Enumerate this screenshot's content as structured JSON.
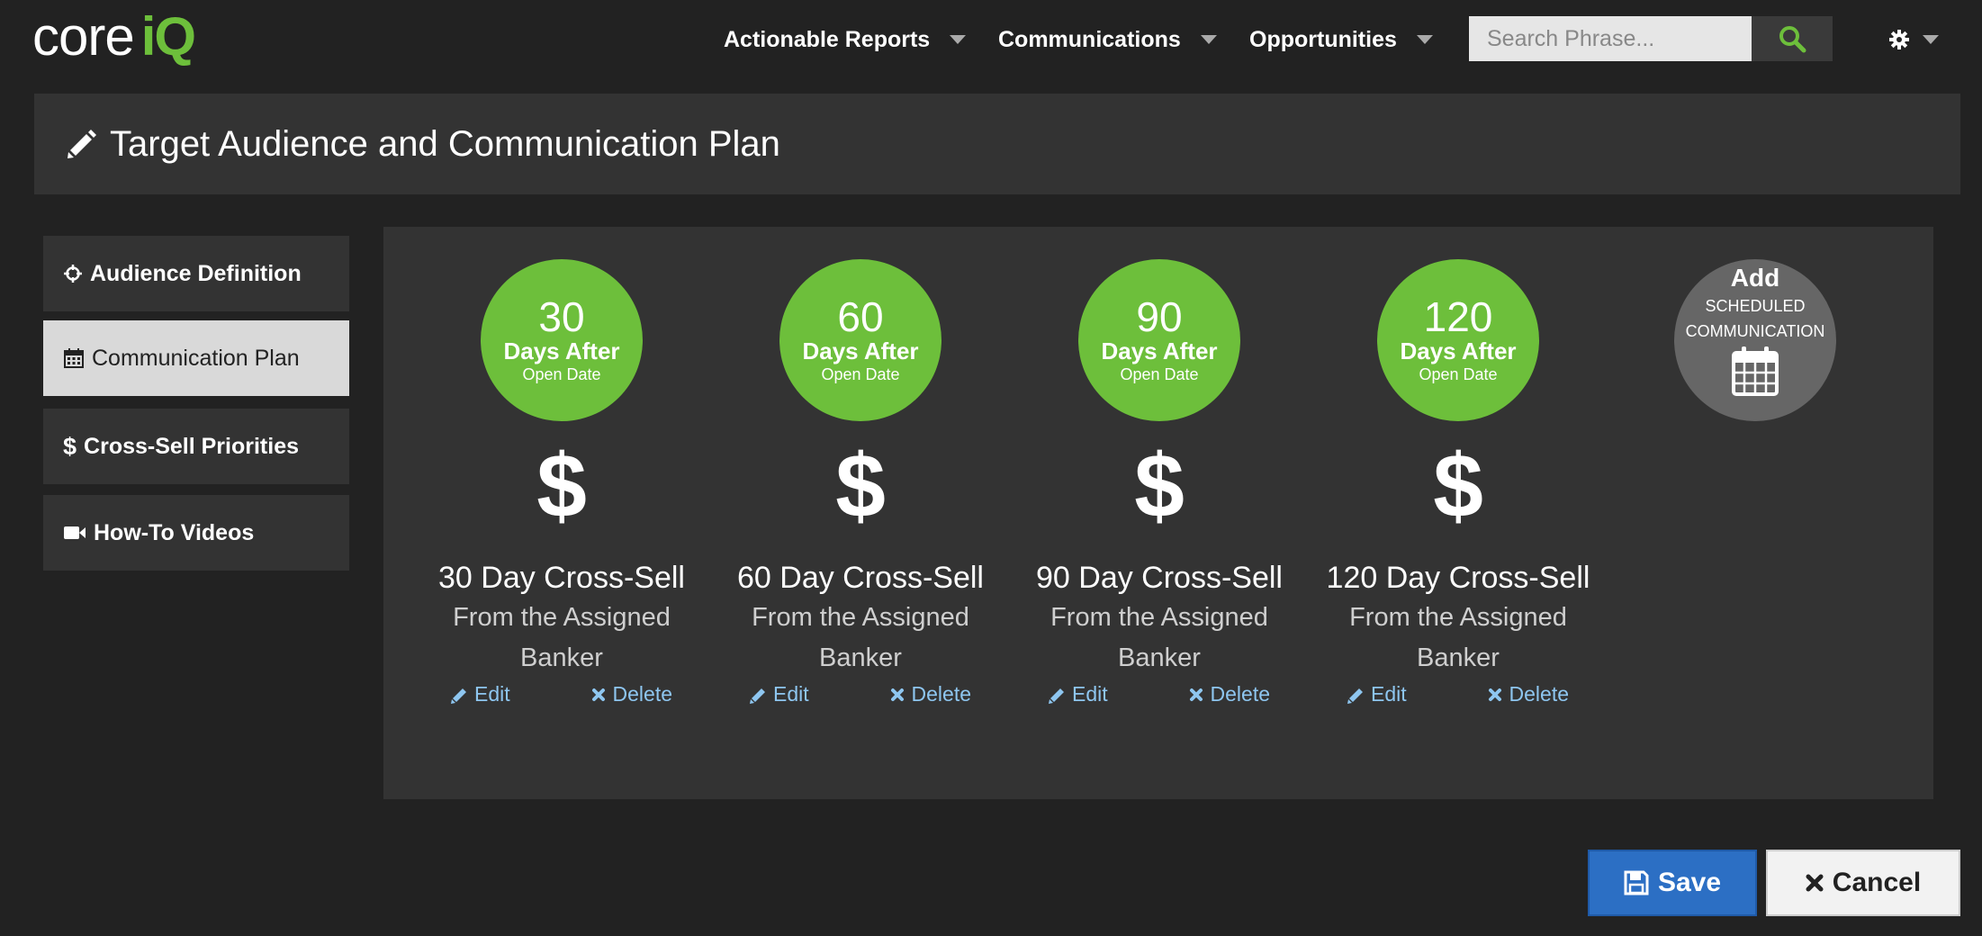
{
  "brand": {
    "logo_core": "core",
    "logo_iq": "iQ",
    "accent_color": "#6dbf3b"
  },
  "nav": {
    "items": [
      {
        "label": "Actionable Reports"
      },
      {
        "label": "Communications"
      },
      {
        "label": "Opportunities"
      }
    ],
    "search": {
      "placeholder": "Search Phrase...",
      "value": ""
    },
    "search_icon": "search-icon",
    "settings_icon": "gear-icon"
  },
  "header": {
    "title": "Target Audience and Communication Plan",
    "icon": "pencil-icon"
  },
  "sidebar": {
    "items": [
      {
        "label": "Audience Definition",
        "icon": "crosshairs-icon",
        "active": false
      },
      {
        "label": "Communication Plan",
        "icon": "calendar-icon",
        "active": true
      },
      {
        "label": "Cross-Sell Priorities",
        "icon": "dollar-icon",
        "active": false
      },
      {
        "label": "How-To Videos",
        "icon": "video-camera-icon",
        "active": false
      }
    ]
  },
  "communications": [
    {
      "days": "30",
      "days_label": "Days After",
      "open_label": "Open Date",
      "symbol": "$",
      "title": "30 Day Cross-Sell",
      "subtitle": "From the Assigned Banker",
      "edit_label": "Edit",
      "delete_label": "Delete"
    },
    {
      "days": "60",
      "days_label": "Days After",
      "open_label": "Open Date",
      "symbol": "$",
      "title": "60 Day Cross-Sell",
      "subtitle": "From the Assigned Banker",
      "edit_label": "Edit",
      "delete_label": "Delete"
    },
    {
      "days": "90",
      "days_label": "Days After",
      "open_label": "Open Date",
      "symbol": "$",
      "title": "90 Day Cross-Sell",
      "subtitle": "From the Assigned Banker",
      "edit_label": "Edit",
      "delete_label": "Delete"
    },
    {
      "days": "120",
      "days_label": "Days After",
      "open_label": "Open Date",
      "symbol": "$",
      "title": "120 Day Cross-Sell",
      "subtitle": "From the Assigned Banker",
      "edit_label": "Edit",
      "delete_label": "Delete"
    }
  ],
  "add_scheduled": {
    "add_label": "Add",
    "line1": "SCHEDULED",
    "line2": "COMMUNICATION",
    "icon": "calendar-icon"
  },
  "footer": {
    "save_label": "Save",
    "cancel_label": "Cancel",
    "save_color": "#2c6fc4"
  }
}
